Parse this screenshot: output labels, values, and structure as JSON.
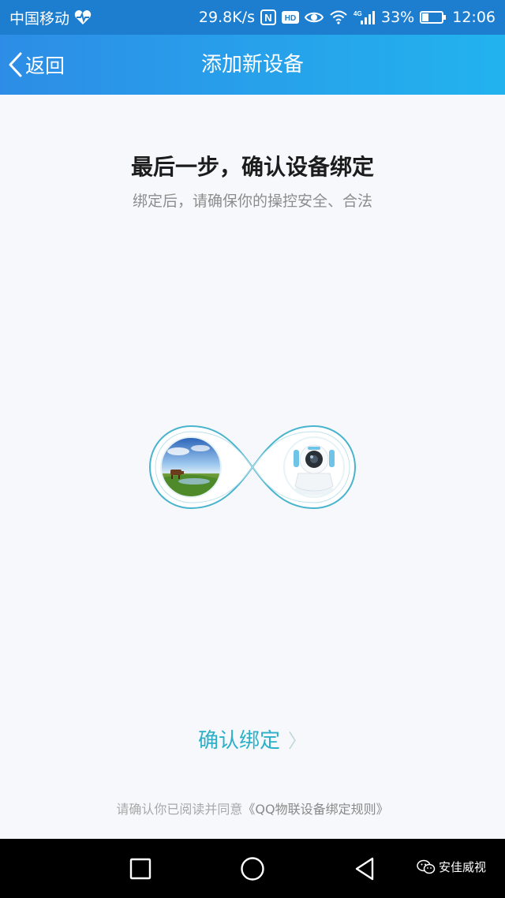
{
  "status_bar": {
    "carrier": "中国移动",
    "net_speed": "29.8K/s",
    "nfc_badge": "N",
    "hd_badge": "HD",
    "network_type": "4G",
    "battery_percent": "33%",
    "battery_level": 0.33,
    "time": "12:06"
  },
  "nav": {
    "back_label": "返回",
    "title": "添加新设备"
  },
  "main": {
    "heading": "最后一步，确认设备绑定",
    "subheading": "绑定后，请确保你的操控安全、合法",
    "confirm_label": "确认绑定",
    "agreement_text": "请确认你已阅读并同意",
    "agreement_link": "《QQ物联设备绑定规则》"
  },
  "watermark": {
    "text": "安佳威视"
  },
  "colors": {
    "status_bar": "#1d7ed0",
    "nav_gradient_start": "#2d8de6",
    "nav_gradient_end": "#22b3ee",
    "accent": "#2bb0c8",
    "background": "#f7f8fb"
  },
  "icons": {
    "status": [
      "heart-rate-icon",
      "nfc-icon",
      "hd-icon",
      "eye-icon",
      "wifi-icon",
      "signal-icon",
      "battery-icon"
    ],
    "nav": [
      "back-chevron-icon"
    ],
    "system": [
      "recent-apps-icon",
      "home-icon",
      "back-triangle-icon"
    ],
    "watermark": [
      "wechat-icon"
    ]
  }
}
